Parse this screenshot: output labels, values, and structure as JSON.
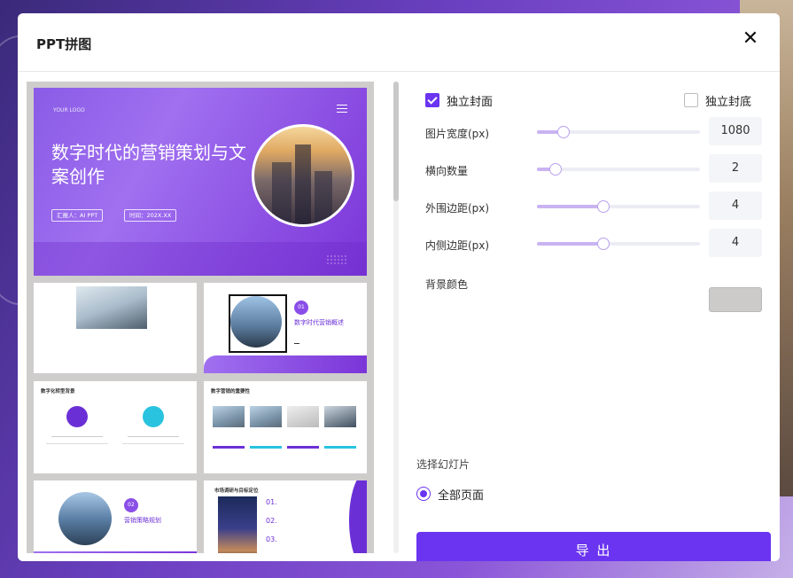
{
  "dialog": {
    "title": "PPT拼图",
    "close_icon": "close-icon"
  },
  "preview": {
    "cover": {
      "logo": "YOUR LOGO",
      "headline": "数字时代的营销策划与文案创作",
      "reporter": "汇报人：AI PPT",
      "time": "时间：202X.XX"
    },
    "slide3": {
      "number": "01",
      "title": "数字时代营销概述"
    },
    "slide4": {
      "title": "数字化转型背景"
    },
    "slide5": {
      "title": "数字营销的重要性"
    },
    "slide6": {
      "number": "02",
      "title": "营销策略规划"
    },
    "slide7": {
      "title": "市场调研与目标定位",
      "items": [
        "01.",
        "02.",
        "03."
      ]
    }
  },
  "settings": {
    "independent_cover": {
      "label": "独立封面",
      "checked": true
    },
    "independent_back": {
      "label": "独立封底",
      "checked": false
    },
    "rows": [
      {
        "label": "图片宽度(px)",
        "value": "1080",
        "fraction": 0.16
      },
      {
        "label": "横向数量",
        "value": "2",
        "fraction": 0.11
      },
      {
        "label": "外围边距(px)",
        "value": "4",
        "fraction": 0.4
      },
      {
        "label": "内侧边距(px)",
        "value": "4",
        "fraction": 0.4
      }
    ],
    "bg_color": {
      "label": "背景颜色",
      "value": "#cdcaca"
    },
    "select_slides": {
      "label": "选择幻灯片",
      "option": "全部页面",
      "selected": true
    },
    "export_label": "导 出"
  },
  "colors": {
    "accent": "#6a34f0"
  }
}
